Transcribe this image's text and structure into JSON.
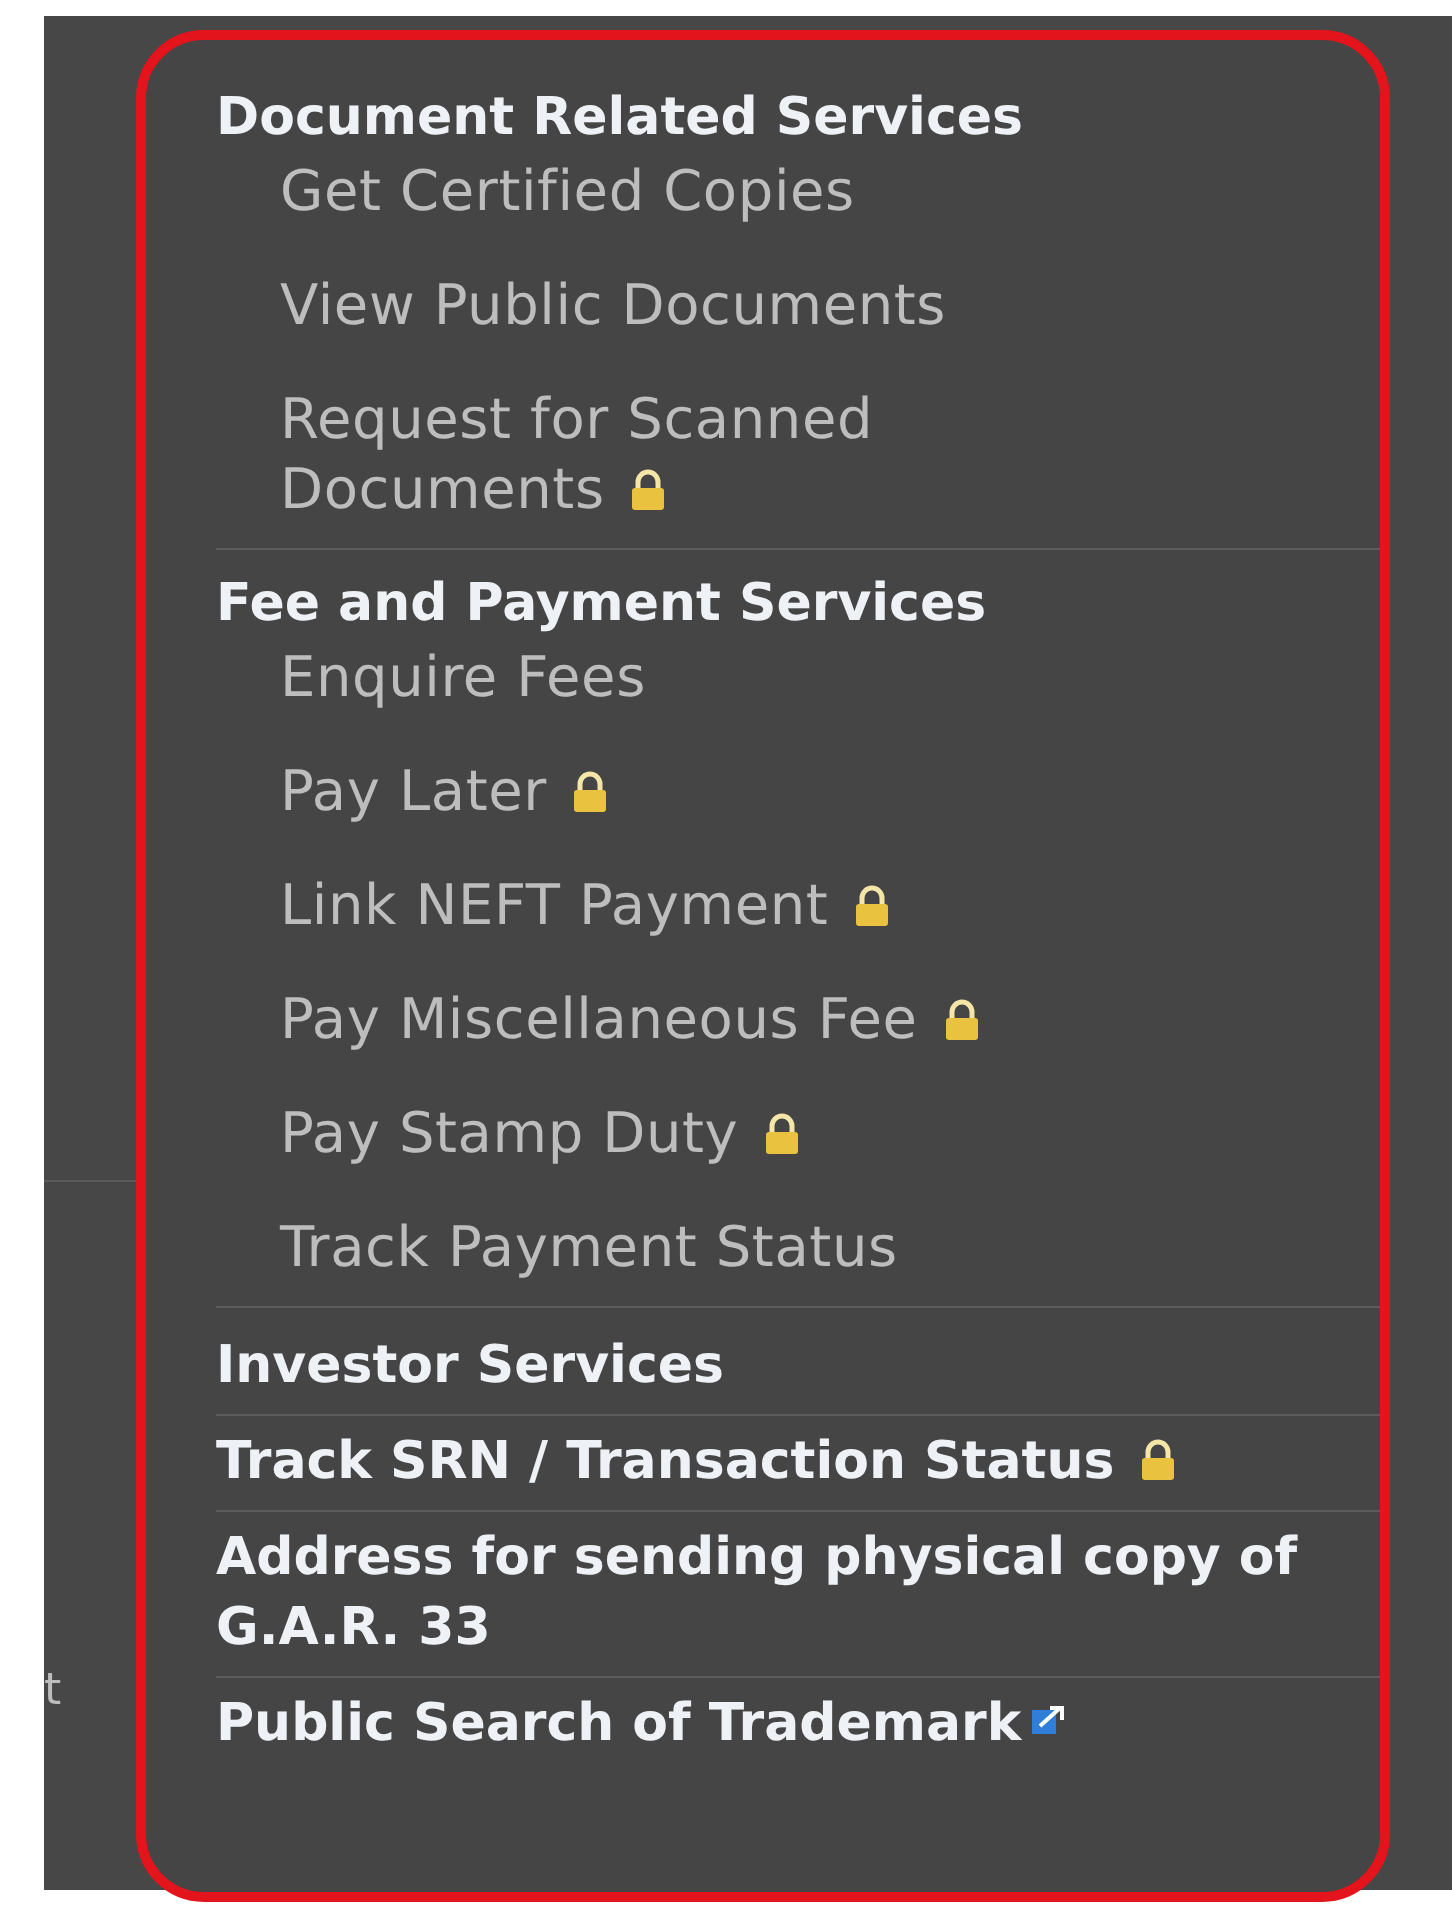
{
  "side_text": "t",
  "menu": [
    {
      "kind": "group",
      "title": "Document Related Services",
      "items": [
        {
          "label": "Get Certified Copies",
          "locked": false
        },
        {
          "label": "View Public Documents",
          "locked": false
        },
        {
          "label": "Request for Scanned Documents",
          "locked": true
        }
      ]
    },
    {
      "kind": "group",
      "title": "Fee and Payment Services",
      "items": [
        {
          "label": "Enquire Fees",
          "locked": false
        },
        {
          "label": "Pay Later",
          "locked": true
        },
        {
          "label": "Link NEFT Payment",
          "locked": true
        },
        {
          "label": "Pay Miscellaneous Fee",
          "locked": true
        },
        {
          "label": "Pay Stamp Duty",
          "locked": true
        },
        {
          "label": "Track Payment Status",
          "locked": false
        }
      ]
    },
    {
      "kind": "link",
      "label": "Investor Services",
      "locked": false,
      "external": false
    },
    {
      "kind": "link",
      "label": "Track SRN / Transaction Status",
      "locked": true,
      "external": false
    },
    {
      "kind": "link",
      "label": "Address for sending physical copy of G.A.R. 33",
      "locked": false,
      "external": false
    },
    {
      "kind": "link",
      "label": "Public Search of Trademark",
      "locked": false,
      "external": true
    }
  ]
}
